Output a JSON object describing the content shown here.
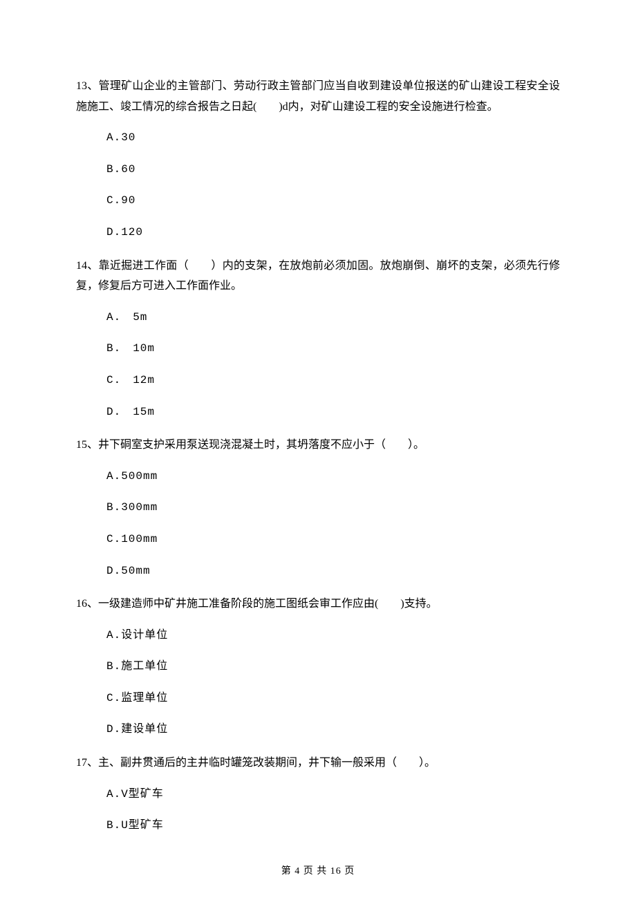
{
  "questions": [
    {
      "number": "13、",
      "text": "管理矿山企业的主管部门、劳动行政主管部门应当自收到建设单位报送的矿山建设工程安全设施施工、竣工情况的综合报告之日起(　　)d内，对矿山建设工程的安全设施进行检查。",
      "options": [
        "A.30",
        "B.60",
        "C.90",
        "D.120"
      ]
    },
    {
      "number": "14、",
      "text": "靠近掘进工作面（　　）内的支架，在放炮前必须加固。放炮崩倒、崩坏的支架，必须先行修复，修复后方可进入工作面作业。",
      "options": [
        "A.　5m",
        "B.　10m",
        "C.　12m",
        "D.　15m"
      ]
    },
    {
      "number": "15、",
      "text": "井下硐室支护采用泵送现浇混凝土时，其坍落度不应小于（　　）。",
      "options": [
        "A.500mm",
        "B.300mm",
        "C.100mm",
        "D.50mm"
      ]
    },
    {
      "number": "16、",
      "text": "一级建造师中矿井施工准备阶段的施工图纸会审工作应由(　　)支持。",
      "options": [
        "A.设计单位",
        "B.施工单位",
        "C.监理单位",
        "D.建设单位"
      ]
    },
    {
      "number": "17、",
      "text": "主、副井贯通后的主井临时罐笼改装期间，井下输一般采用（　　）。",
      "options": [
        "A.V型矿车",
        "B.U型矿车"
      ]
    }
  ],
  "footer": "第 4 页 共 16 页"
}
